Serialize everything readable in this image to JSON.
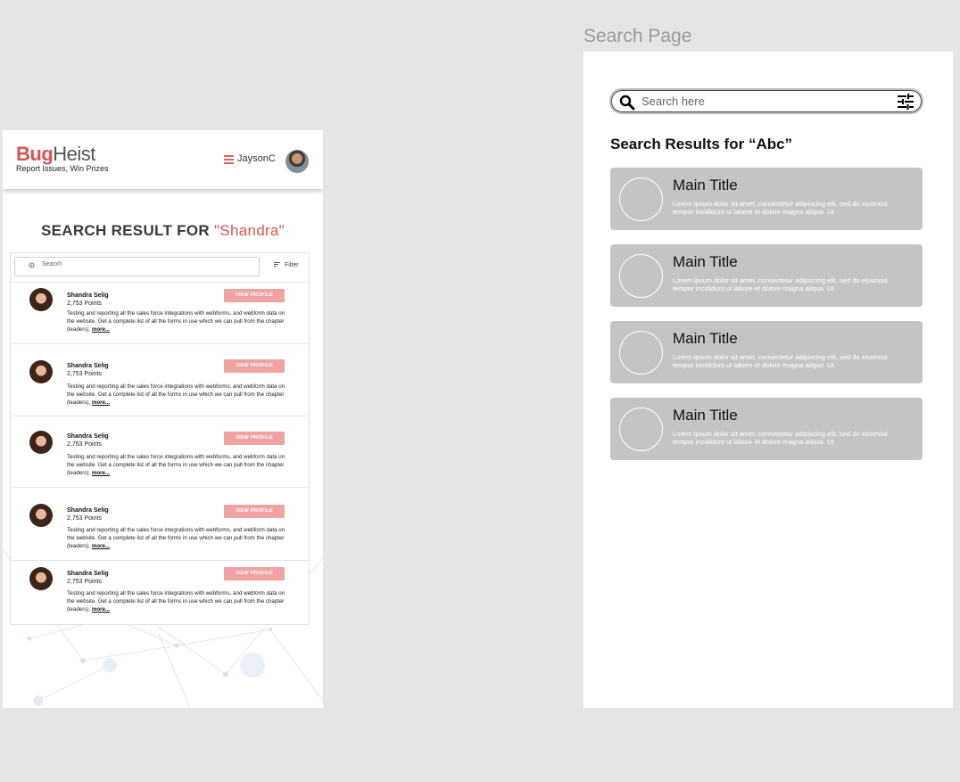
{
  "left": {
    "logo": {
      "bug": "Bug",
      "heist": "Heist",
      "tagline": "Report Issues, Win Prizes"
    },
    "header": {
      "username": "JaysonC"
    },
    "result_title": {
      "prefix": "SEARCH RESULT FOR ",
      "query": "\"Shandra\""
    },
    "search": {
      "placeholder": "Searxh",
      "filter_label": "Filter"
    },
    "results": [
      {
        "name": "Shandra Selig",
        "points": "2,753 Points",
        "button": "VIEW PROFILE",
        "text": "Testing and reporting all the sales force integrations with webforms, and webform data on the website. Get a complete list of all the forms in use which we can pull from the chapter (leaders), ",
        "more": "more..."
      },
      {
        "name": "Shandra Selig",
        "points": "2,753 Points",
        "button": "VIEW PROFILE",
        "text": "Testing and reporting all the sales force integrations with webforms, and webform data on the website. Get a complete list of all the forms in use which we can pull from the chapter (leaders), ",
        "more": "more..."
      },
      {
        "name": "Shandra Selig",
        "points": "2,753 Points",
        "button": "VIEW PROFILE",
        "text": "Testing and reporting all the sales force integrations with webforms, and webform data on the website. Get a complete list of all the forms in use which we can pull from the chapter (leaders), ",
        "more": "more..."
      },
      {
        "name": "Shandra Selig",
        "points": "2,753 Points",
        "button": "VIEW PROFILE",
        "text": "Testing and reporting all the sales force integrations with webforms, and webform data on the website. Get a complete list of all the forms in use which we can pull from the chapter (leaders), ",
        "more": "more..."
      },
      {
        "name": "Shandra Selig",
        "points": "2,753 Points",
        "button": "VIEW PROFILE",
        "text": "Testing and reporting all the sales force integrations with webforms, and webform data on the website. Get a complete list of all the forms in use which we can pull from the chapter (leaders), ",
        "more": "more..."
      }
    ]
  },
  "right": {
    "page_label": "Search Page",
    "search": {
      "placeholder": "Search here"
    },
    "heading": "Search Results for “Abc”",
    "cards": [
      {
        "title": "Main Title",
        "desc": "Lorem ipsum dolor sit amet, consectetur adipiscing elit, sed do eiusmod tempor incididunt ut labore et dolore magna aliqua. Ut"
      },
      {
        "title": "Main Title",
        "desc": "Lorem ipsum dolor sit amet, consectetur adipiscing elit, sed do eiusmod tempor incididunt ut labore et dolore magna aliqua. Ut"
      },
      {
        "title": "Main Title",
        "desc": "Lorem ipsum dolor sit amet, consectetur adipiscing elit, sed do eiusmod tempor incididunt ut labore et dolore magna aliqua. Ut"
      },
      {
        "title": "Main Title",
        "desc": "Lorem ipsum dolor sit amet, consectetur adipiscing elit, sed do eiusmod tempor incididunt ut labore et dolore magna aliqua. Ut"
      }
    ]
  },
  "colors": {
    "brand_red": "#d9534f",
    "button_pink": "#f0a3a3",
    "wireframe_gray": "#c4c4c4",
    "canvas_gray": "#e5e5e5"
  },
  "icons": [
    "menu-icon",
    "avatar",
    "location-icon",
    "filter-icon",
    "search-icon",
    "tune-icon"
  ]
}
